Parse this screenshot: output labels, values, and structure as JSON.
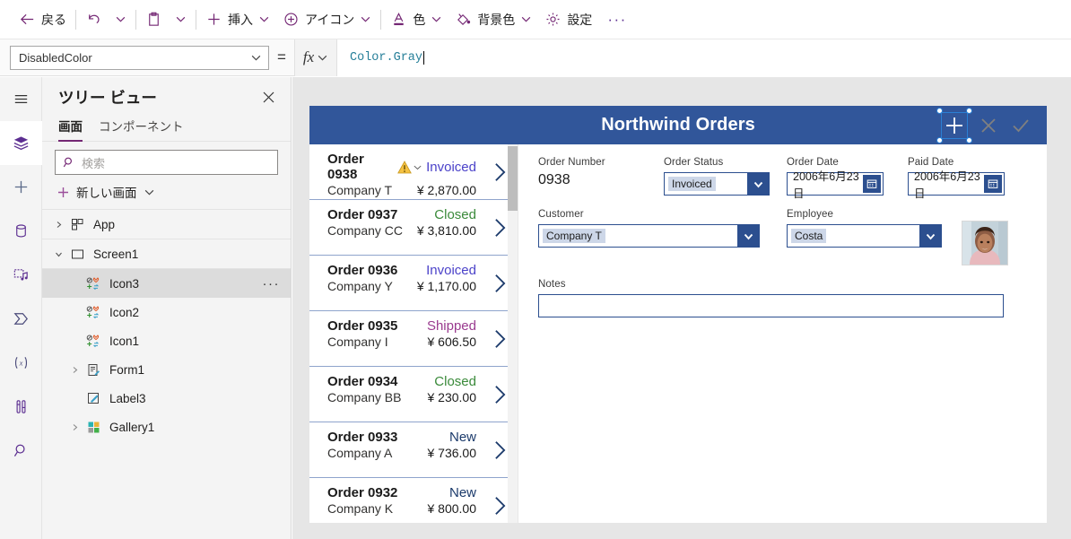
{
  "command_bar": {
    "items": [
      {
        "name": "back",
        "icon": "arrow-left-icon",
        "label": "戻る",
        "has_chevron": false
      },
      {
        "name": "undo",
        "icon": "undo-icon",
        "label": "",
        "has_chevron": false
      },
      {
        "name": "undo-more",
        "icon": "",
        "label": "",
        "has_chevron": true
      },
      {
        "name": "paste",
        "icon": "clipboard-icon",
        "label": "",
        "has_chevron": false
      },
      {
        "name": "paste-more",
        "icon": "",
        "label": "",
        "has_chevron": true
      },
      {
        "name": "insert",
        "icon": "plus-icon",
        "label": "挿入",
        "has_chevron": true
      },
      {
        "name": "icons",
        "icon": "circle-plus-icon",
        "label": "アイコン",
        "has_chevron": true
      },
      {
        "name": "color",
        "icon": "font-color-icon",
        "label": "色",
        "has_chevron": true
      },
      {
        "name": "background-color",
        "icon": "fill-bucket-icon",
        "label": "背景色",
        "has_chevron": true
      },
      {
        "name": "settings",
        "icon": "gear-icon",
        "label": "設定",
        "has_chevron": false
      }
    ],
    "overflow_label": "···"
  },
  "formula_bar": {
    "property": "DisabledColor",
    "equals": "=",
    "fx_label": "fx",
    "formula": "Color.Gray"
  },
  "rail": {
    "items": [
      {
        "name": "menu",
        "icon": "hamburger-icon",
        "active": false
      },
      {
        "name": "tree-view",
        "icon": "layers-icon",
        "active": true
      },
      {
        "name": "insert",
        "icon": "plus-icon",
        "active": false
      },
      {
        "name": "data",
        "icon": "database-icon",
        "active": false
      },
      {
        "name": "media",
        "icon": "media-icon",
        "active": false
      },
      {
        "name": "power-automate",
        "icon": "power-automate-icon",
        "active": false
      },
      {
        "name": "variables",
        "icon": "variables-icon",
        "active": false
      },
      {
        "name": "advanced-tools",
        "icon": "tools-icon",
        "active": false
      },
      {
        "name": "search",
        "icon": "search-icon",
        "active": false
      }
    ]
  },
  "tree_panel": {
    "title": "ツリー ビュー",
    "close_icon": "close-icon",
    "tabs": [
      {
        "label": "画面",
        "active": true
      },
      {
        "label": "コンポーネント",
        "active": false
      }
    ],
    "search_placeholder": "検索",
    "new_screen_label": "新しい画面",
    "nodes": [
      {
        "label": "App",
        "icon": "app-icon",
        "twisty": "collapsed",
        "indent": 0,
        "selected": false,
        "more": false
      },
      {
        "label": "Screen1",
        "icon": "screen-icon",
        "twisty": "expanded",
        "indent": 0,
        "selected": false,
        "more": false
      },
      {
        "label": "Icon3",
        "icon": "icon-control-icon",
        "twisty": "none",
        "indent": 1,
        "selected": true,
        "more": true
      },
      {
        "label": "Icon2",
        "icon": "icon-control-icon",
        "twisty": "none",
        "indent": 1,
        "selected": false,
        "more": false
      },
      {
        "label": "Icon1",
        "icon": "icon-control-icon",
        "twisty": "none",
        "indent": 1,
        "selected": false,
        "more": false
      },
      {
        "label": "Form1",
        "icon": "form-icon",
        "twisty": "collapsed",
        "indent": 1,
        "selected": false,
        "more": false
      },
      {
        "label": "Label3",
        "icon": "label-icon",
        "twisty": "none",
        "indent": 1,
        "selected": false,
        "more": false
      },
      {
        "label": "Gallery1",
        "icon": "gallery-icon",
        "twisty": "collapsed",
        "indent": 1,
        "selected": false,
        "more": false
      }
    ]
  },
  "app": {
    "title": "Northwind Orders",
    "header_color": "#31569a",
    "header_icons": [
      {
        "name": "add-order-icon",
        "glyph": "plus",
        "state": "selected",
        "color": "#ffffff"
      },
      {
        "name": "cancel-icon",
        "glyph": "x",
        "state": "disabled",
        "color": "#808080"
      },
      {
        "name": "confirm-icon",
        "glyph": "check",
        "state": "disabled",
        "color": "#808080"
      }
    ],
    "gallery": {
      "rows": [
        {
          "order": "Order 0938",
          "company": "Company T",
          "status": "Invoiced",
          "status_color": "#4b42c9",
          "amount": "¥ 2,870.00",
          "warning": true,
          "selected": true
        },
        {
          "order": "Order 0937",
          "company": "Company CC",
          "status": "Closed",
          "status_color": "#3a8a3a",
          "amount": "¥ 3,810.00",
          "warning": false,
          "selected": false
        },
        {
          "order": "Order 0936",
          "company": "Company Y",
          "status": "Invoiced",
          "status_color": "#4b42c9",
          "amount": "¥ 1,170.00",
          "warning": false,
          "selected": false
        },
        {
          "order": "Order 0935",
          "company": "Company I",
          "status": "Shipped",
          "status_color": "#9a3b8f",
          "amount": "¥ 606.50",
          "warning": false,
          "selected": false
        },
        {
          "order": "Order 0934",
          "company": "Company BB",
          "status": "Closed",
          "status_color": "#3a8a3a",
          "amount": "¥ 230.00",
          "warning": false,
          "selected": false
        },
        {
          "order": "Order 0933",
          "company": "Company A",
          "status": "New",
          "status_color": "#1b3a6b",
          "amount": "¥ 736.00",
          "warning": false,
          "selected": false
        },
        {
          "order": "Order 0932",
          "company": "Company K",
          "status": "New",
          "status_color": "#1b3a6b",
          "amount": "¥ 800.00",
          "warning": false,
          "selected": false
        }
      ]
    },
    "form": {
      "order_number_label": "Order Number",
      "order_number_value": "0938",
      "order_status_label": "Order Status",
      "order_status_value": "Invoiced",
      "order_date_label": "Order Date",
      "order_date_value": "2006年6月23日",
      "paid_date_label": "Paid Date",
      "paid_date_value": "2006年6月23日",
      "customer_label": "Customer",
      "customer_value": "Company T",
      "employee_label": "Employee",
      "employee_value": "Costa",
      "employee_photo_name": "employee-photo",
      "notes_label": "Notes",
      "notes_value": ""
    }
  }
}
